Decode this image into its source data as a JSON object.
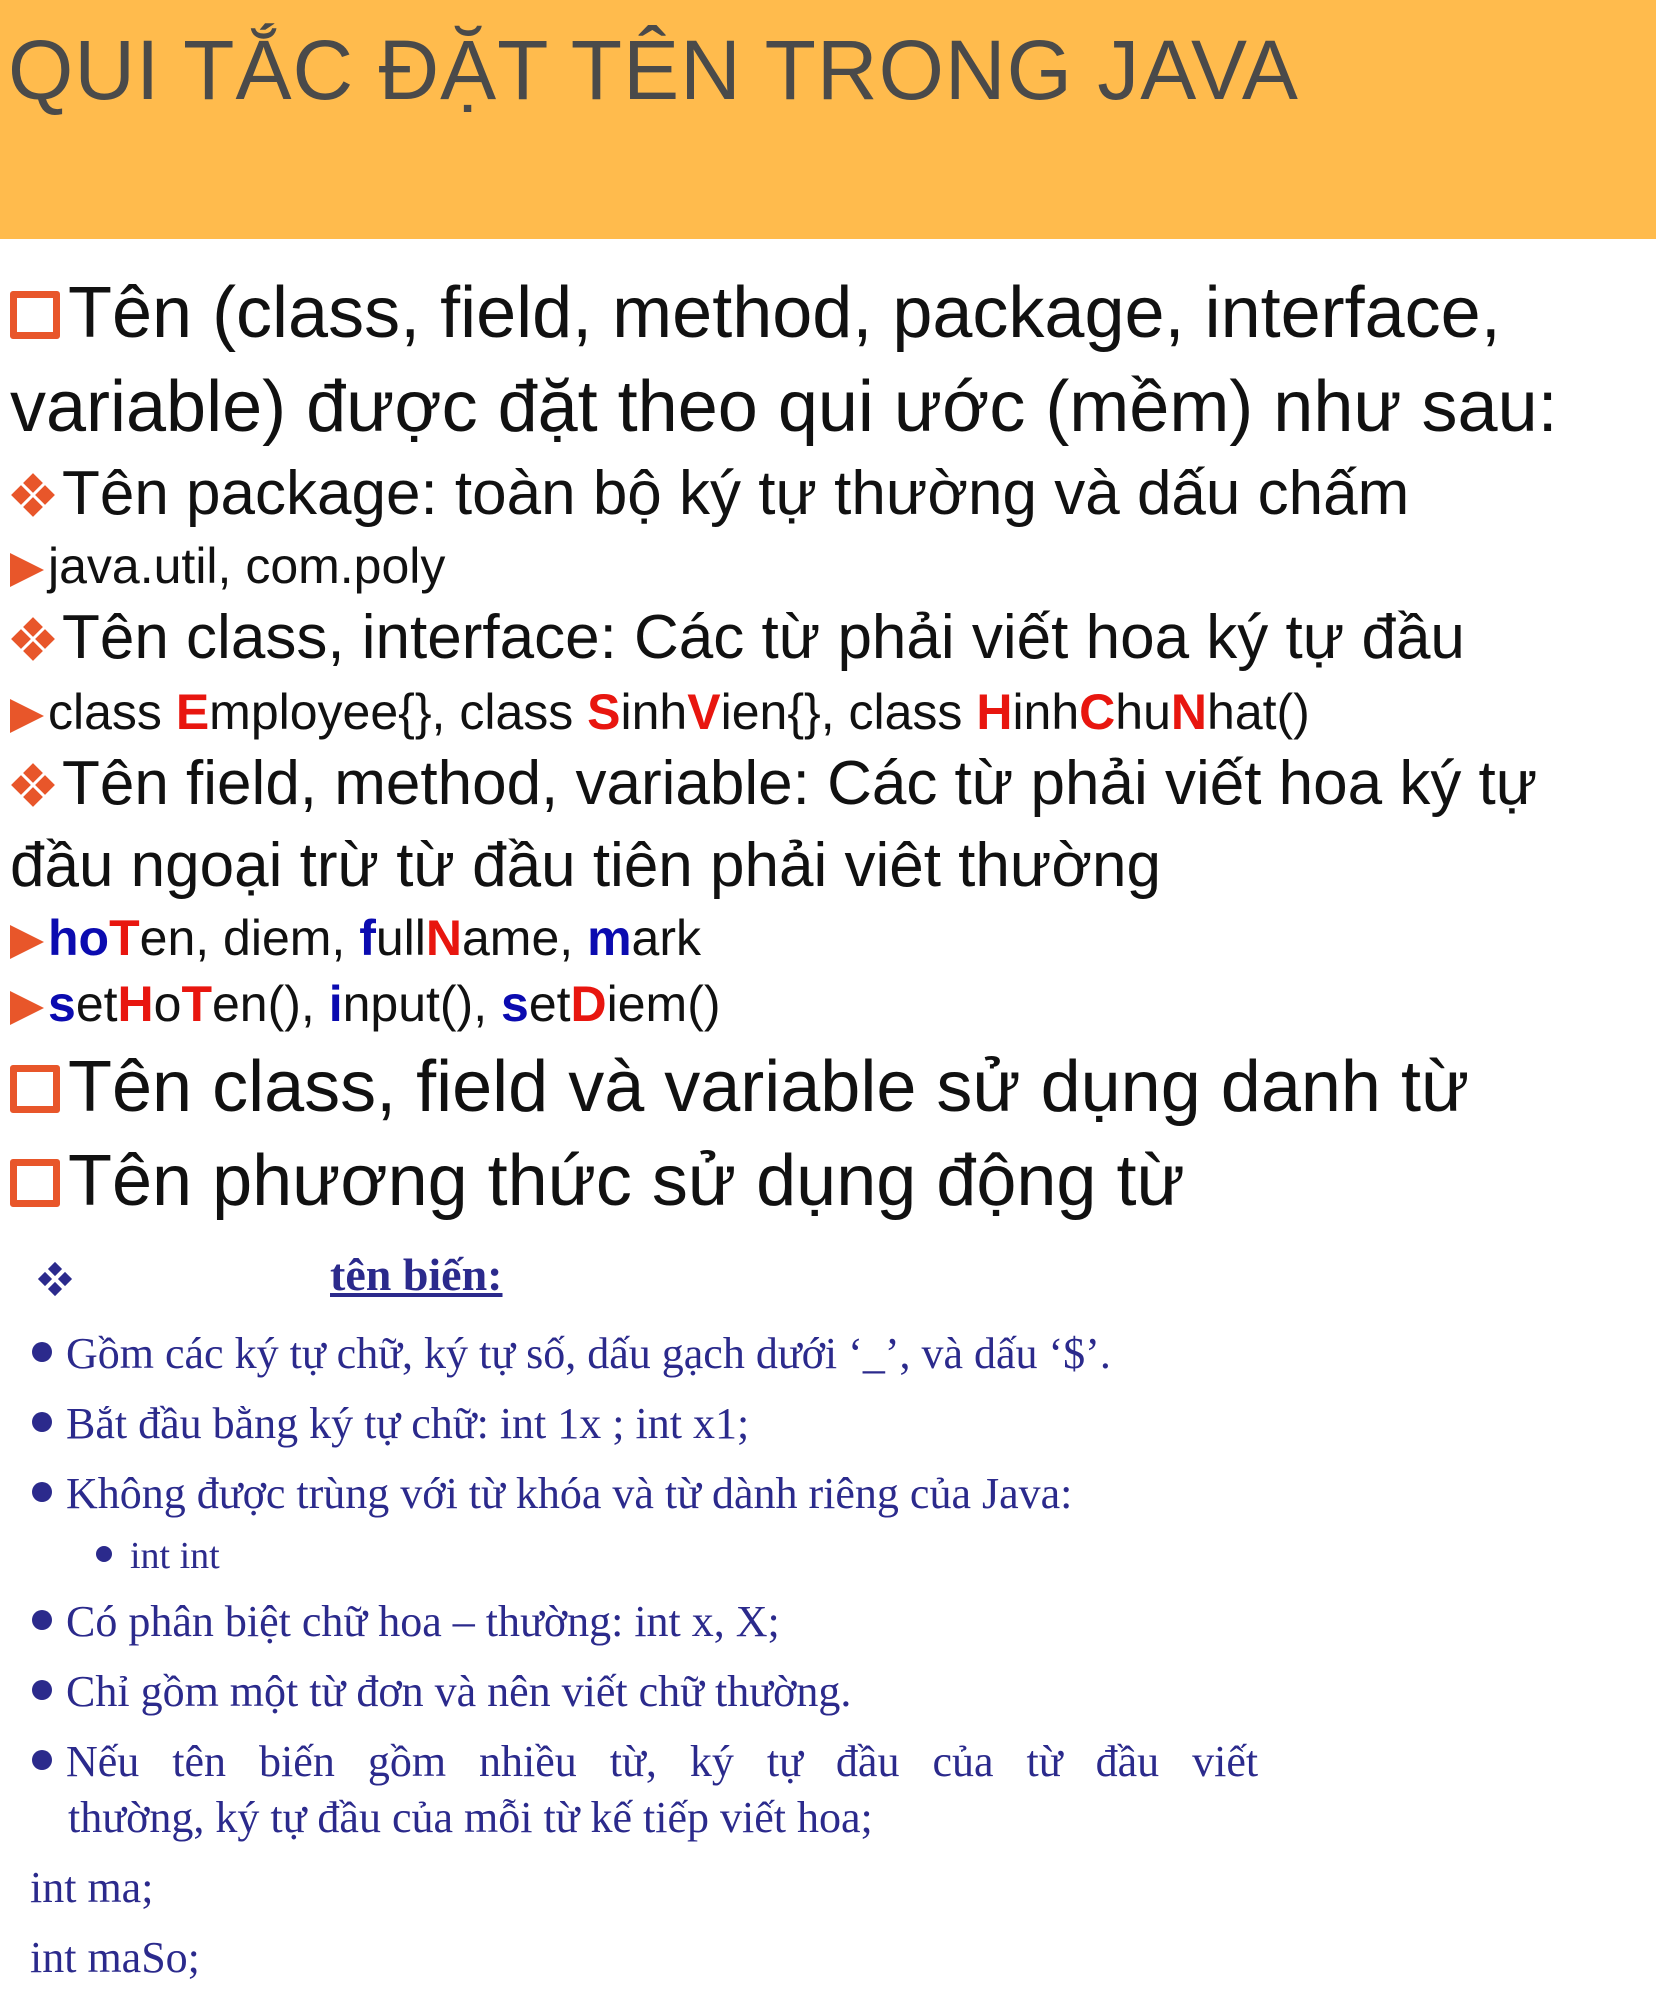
{
  "title": "QUI TẮC ĐẶT TÊN TRONG JAVA",
  "colors": {
    "header_bg": "#FFBB4D",
    "accent": "#E8562A",
    "highlight_red": "#E8160F",
    "highlight_blue": "#0b0bb0",
    "body_blue": "#2b2a8c"
  },
  "rule1": {
    "line1": "Tên (class, field, method, package, interface,",
    "line2": "variable) được đặt theo qui ước (mềm) như sau:"
  },
  "package_rule": {
    "text": "Tên package: toàn bộ ký tự thường và dấu chấm",
    "example": "java.util, com.poly"
  },
  "class_rule": {
    "text": "Tên class, interface: Các từ phải viết hoa ký tự đầu",
    "example": [
      {
        "t": "class ",
        "s": ""
      },
      {
        "t": "E",
        "s": "red"
      },
      {
        "t": "mployee{}, class ",
        "s": ""
      },
      {
        "t": "S",
        "s": "red"
      },
      {
        "t": "inh",
        "s": ""
      },
      {
        "t": "V",
        "s": "red"
      },
      {
        "t": "ien{}, class ",
        "s": ""
      },
      {
        "t": "H",
        "s": "red"
      },
      {
        "t": "inh",
        "s": ""
      },
      {
        "t": "C",
        "s": "red"
      },
      {
        "t": "hu",
        "s": ""
      },
      {
        "t": "N",
        "s": "red"
      },
      {
        "t": "hat()",
        "s": ""
      }
    ]
  },
  "field_rule": {
    "line1": "Tên field, method, variable: Các từ phải viết hoa ký tự",
    "line2": "đầu ngoại trừ từ đầu tiên phải viêt thường",
    "example1": [
      {
        "t": "ho",
        "s": "blue"
      },
      {
        "t": "T",
        "s": "red"
      },
      {
        "t": "en, diem, ",
        "s": ""
      },
      {
        "t": "f",
        "s": "blue"
      },
      {
        "t": "ull",
        "s": ""
      },
      {
        "t": "N",
        "s": "red"
      },
      {
        "t": "ame, ",
        "s": ""
      },
      {
        "t": "m",
        "s": "blue"
      },
      {
        "t": "ark",
        "s": ""
      }
    ],
    "example2": [
      {
        "t": "s",
        "s": "blue"
      },
      {
        "t": "et",
        "s": ""
      },
      {
        "t": "H",
        "s": "red"
      },
      {
        "t": "o",
        "s": ""
      },
      {
        "t": "T",
        "s": "red"
      },
      {
        "t": "en(), ",
        "s": ""
      },
      {
        "t": "i",
        "s": "blue"
      },
      {
        "t": "nput(), ",
        "s": ""
      },
      {
        "t": "s",
        "s": "blue"
      },
      {
        "t": "et",
        "s": ""
      },
      {
        "t": "D",
        "s": "red"
      },
      {
        "t": "iem()",
        "s": ""
      }
    ]
  },
  "rule2": "Tên class, field và variable sử dụng danh từ",
  "rule3": "Tên phương thức sử dụng động từ",
  "variable_section": {
    "heading": "tên biến:",
    "items": [
      "Gồm các ký tự chữ, ký tự số, dấu gạch dưới ‘_’, và dấu ‘$’.",
      "Bắt đầu bằng ký tự chữ: int 1x ; int x1;",
      "Không được trùng với từ khóa và từ dành riêng của Java:"
    ],
    "subitem": "int int",
    "items2": [
      "Có phân biệt chữ hoa – thường: int x, X;",
      "Chỉ gồm một từ đơn và nên viết chữ thường.",
      "Nếu   tên   biến   gồm   nhiều   từ,   ký   tự   đầu   của   từ   đầu   viết"
    ],
    "wrap": "thường, ký tự đầu của mỗi từ kế tiếp viết hoa;",
    "code1": "int ma;",
    "code2": "int maSo;"
  }
}
